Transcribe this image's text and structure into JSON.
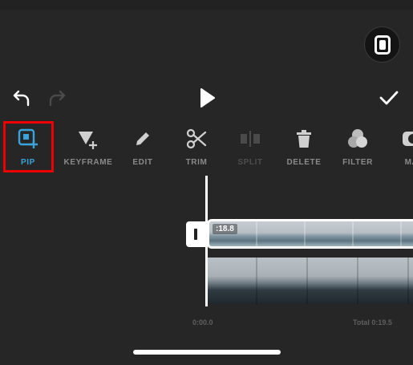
{
  "controls": {
    "undo_icon": "undo-arrow-icon",
    "redo_icon": "redo-arrow-icon",
    "play_icon": "play-icon",
    "done_icon": "checkmark-icon",
    "preview_icon": "fullscreen-preview-icon"
  },
  "toolbar": {
    "items": [
      {
        "label": "PIP",
        "icon": "pip-add-icon",
        "state": "active"
      },
      {
        "label": "KEYFRAME",
        "icon": "keyframe-add-icon",
        "state": "normal"
      },
      {
        "label": "EDIT",
        "icon": "pencil-icon",
        "state": "normal"
      },
      {
        "label": "TRIM",
        "icon": "scissors-icon",
        "state": "normal"
      },
      {
        "label": "SPLIT",
        "icon": "split-icon",
        "state": "disabled"
      },
      {
        "label": "DELETE",
        "icon": "trash-icon",
        "state": "normal"
      },
      {
        "label": "FILTER",
        "icon": "filter-circles-icon",
        "state": "normal"
      },
      {
        "label": "MA",
        "icon": "mask-icon",
        "state": "normal"
      }
    ]
  },
  "timeline": {
    "pip_clip_duration": ":18.8",
    "start_time": "0:00.0",
    "total_time": "Total 0:19.5"
  },
  "colors": {
    "background": "#262626",
    "active_accent": "#3aa3d9",
    "highlight_box": "#e00000"
  }
}
